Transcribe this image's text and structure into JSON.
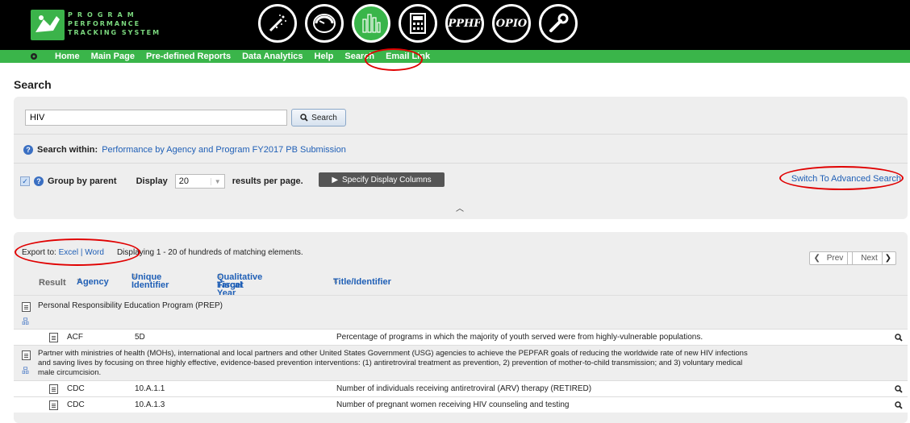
{
  "header": {
    "logo_lines": [
      "PROGRAM",
      "PERFORMANCE",
      "TRACKING SYSTEM"
    ],
    "big_icons": [
      {
        "name": "wand-icon",
        "label": ""
      },
      {
        "name": "gauge-icon",
        "label": ""
      },
      {
        "name": "data-building-icon",
        "label": ""
      },
      {
        "name": "calculator-icon",
        "label": ""
      },
      {
        "name": "pphf-icon",
        "label": "PPHF"
      },
      {
        "name": "opio-icon",
        "label": "OPIO"
      },
      {
        "name": "wrench-icon",
        "label": ""
      }
    ]
  },
  "nav": {
    "items": [
      "Home",
      "Main Page",
      "Pre-defined Reports",
      "Data Analytics",
      "Help",
      "Search",
      "Email Link"
    ]
  },
  "page": {
    "title": "Search"
  },
  "search": {
    "query": "HIV",
    "button_label": "Search",
    "within_label": "Search within:",
    "within_value": "Performance by Agency and Program FY2017 PB Submission",
    "group_by_parent_label": "Group by parent",
    "display_label": "Display",
    "display_value": "20",
    "per_page_label": "results per page.",
    "specify_columns_label": "Specify Display Columns",
    "advanced_search_label": "Switch To Advanced Search"
  },
  "results": {
    "export_label": "Export to:",
    "export_excel": "Excel",
    "export_separator": "|",
    "export_word": "Word",
    "summary": "Displaying 1 - 20 of hundreds of matching elements.",
    "prev_label": "Prev",
    "next_label": "Next",
    "columns": {
      "result": "Result",
      "agency": "Agency",
      "unique_identifier_1": "Unique",
      "unique_identifier_2": "Identifier",
      "fiscal_year_1": "Qualitative Target",
      "fiscal_year_2": "Fiscal Year",
      "title": "Title/Identifier"
    },
    "groups": [
      {
        "title": "Personal Responsibility Education Program (PREP)",
        "rows": [
          {
            "agency": "ACF",
            "id": "5D",
            "title": "Percentage of programs in which the majority of youth served were from highly-vulnerable populations."
          }
        ]
      },
      {
        "title_line1": "Partner with ministries of health (MOHs), international and local partners and other United States Government (USG) agencies to achieve the PEPFAR goals of reducing the worldwide rate of new HIV infections",
        "title_line2": "and saving lives by focusing on three highly effective, evidence-based prevention interventions: (1) antiretroviral treatment as prevention, 2) prevention of mother-to-child transmission; and 3) voluntary medical",
        "title_line3": "male circumcision.",
        "rows": [
          {
            "agency": "CDC",
            "id": "10.A.1.1",
            "title": "Number of individuals receiving antiretroviral (ARV) therapy (RETIRED)"
          },
          {
            "agency": "CDC",
            "id": "10.A.1.3",
            "title": "Number of pregnant women receiving HIV counseling and testing"
          }
        ]
      }
    ]
  },
  "colors": {
    "nav_green": "#3ab54a",
    "header_black": "#000000",
    "link_blue": "#1f5fb6",
    "highlight_red": "#e00000"
  }
}
